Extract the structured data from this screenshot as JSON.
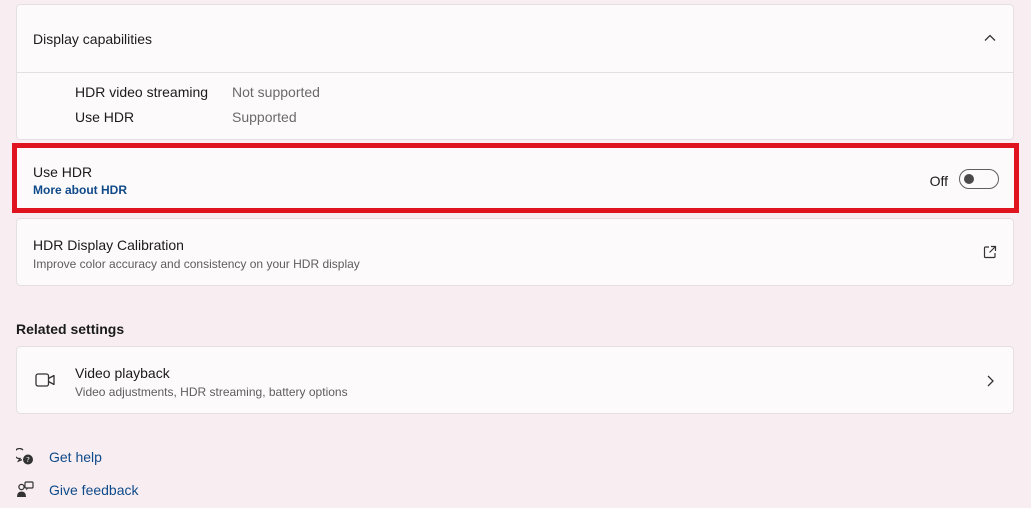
{
  "capabilities": {
    "title": "Display capabilities",
    "rows": [
      {
        "label": "HDR video streaming",
        "value": "Not supported"
      },
      {
        "label": "Use HDR",
        "value": "Supported"
      }
    ]
  },
  "use_hdr": {
    "title": "Use HDR",
    "link": "More about HDR",
    "state": "Off",
    "toggle_on": false
  },
  "calibration": {
    "title": "HDR Display Calibration",
    "subtitle": "Improve color accuracy and consistency on your HDR display"
  },
  "related": {
    "heading": "Related settings",
    "video": {
      "title": "Video playback",
      "subtitle": "Video adjustments, HDR streaming, battery options"
    }
  },
  "footer": {
    "help": "Get help",
    "feedback": "Give feedback"
  },
  "colors": {
    "highlight": "#e0141f",
    "link": "#0f4a8a"
  }
}
